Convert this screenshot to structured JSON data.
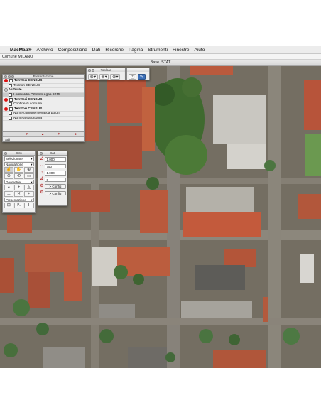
{
  "menubar": {
    "apple": "",
    "app": "MacMap®",
    "items": [
      "Archivio",
      "Composizione",
      "Dati",
      "Ricerche",
      "Pagina",
      "Strumenti",
      "Finestre",
      "Aiuto"
    ]
  },
  "document": {
    "title": "Comune MILANO"
  },
  "window": {
    "title": "Base ISTAT"
  },
  "layers_palette": {
    "title": "Presentazione",
    "rows": [
      {
        "label": "Territori CENSUS",
        "visible": true,
        "group": true
      },
      {
        "label": "Territori CENSUS",
        "visible": true,
        "group": false
      },
      {
        "label": "Virtuale",
        "visible": false,
        "group": true
      },
      {
        "label": "Lombardia Ortofoto Agea 2015",
        "visible": true,
        "group": false,
        "selected": true
      },
      {
        "label": "Territori CENSUS",
        "visible": true,
        "group": true
      },
      {
        "label": "Confine di comune",
        "visible": true,
        "group": false
      },
      {
        "label": "Territori CENSUS",
        "visible": true,
        "group": true
      },
      {
        "label": "Nome comune rilevatica bold 4",
        "visible": true,
        "group": false
      },
      {
        "label": "Nome area urbana",
        "visible": true,
        "group": false
      }
    ],
    "footer": "Stili",
    "foot_icons": [
      "+",
      "▾",
      "▴",
      "✕",
      "●"
    ]
  },
  "toolbar_palette": {
    "title": "Toolbar",
    "buttons": [
      "⊗▾",
      "⊗▾",
      "⊗▾"
    ]
  },
  "selector_palette": {
    "buttons": [
      "◰",
      "✎"
    ]
  },
  "tools_palette": {
    "title": "Stru",
    "select1": "Selezionare",
    "select2": "Navigazione",
    "section2": "Geometrie",
    "section3": "Presentazione",
    "grid1": [
      "☝",
      "✋",
      "⊕",
      "⊖",
      "⟲",
      "▭"
    ],
    "grid2": [
      "⌐",
      "+",
      "◬",
      "⊥",
      "✕",
      "⌖"
    ],
    "grid3": [
      "⊞",
      "⇱",
      "T",
      "⌕",
      "✥",
      "◇"
    ]
  },
  "dati_palette": {
    "title": "Dati",
    "fields": [
      "1.000",
      "750",
      "1.000",
      "0"
    ],
    "button1": "> Config",
    "button2": "> Config"
  },
  "colors": {
    "accent": "#3c6fb9",
    "layer_red": "#dd1111",
    "menubar": "#ececec"
  }
}
